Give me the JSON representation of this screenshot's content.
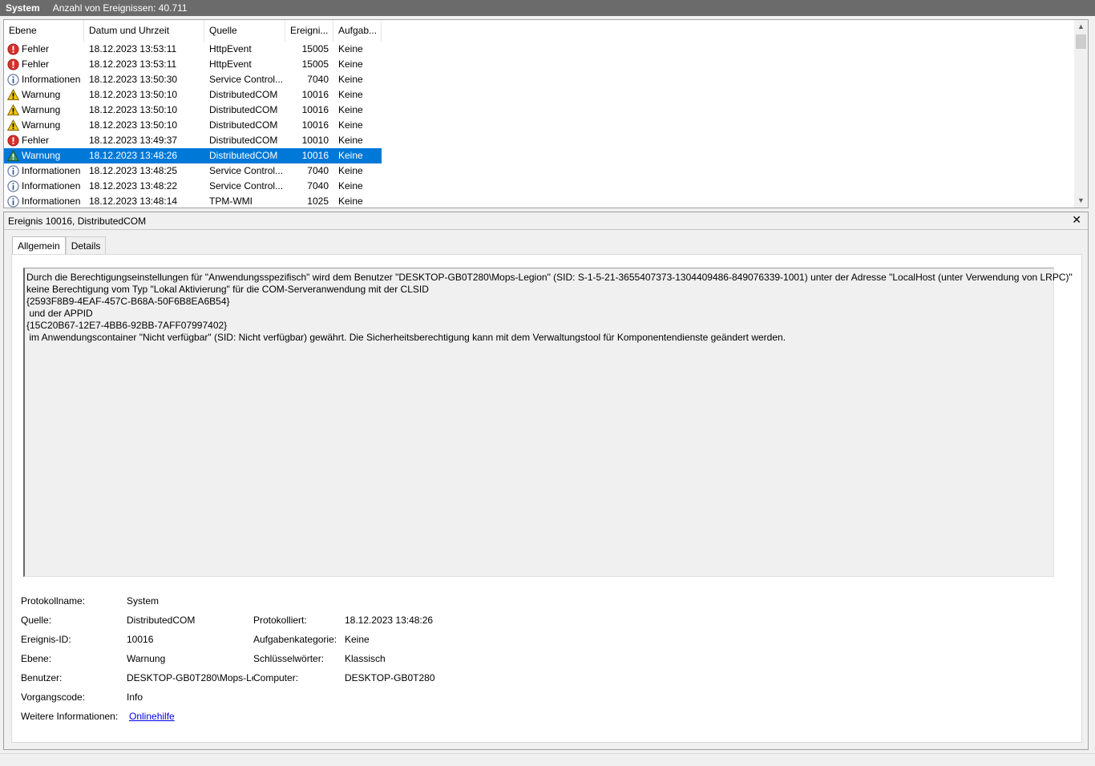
{
  "title_bar": {
    "log_name": "System",
    "event_count": "Anzahl von Ereignissen: 40.711"
  },
  "columns": [
    "Ebene",
    "Datum und Uhrzeit",
    "Quelle",
    "Ereigni...",
    "Aufgab..."
  ],
  "events": [
    {
      "level": "Fehler",
      "icon": "error-icon",
      "datetime": "18.12.2023 13:53:11",
      "source": "HttpEvent",
      "id": "15005",
      "task": "Keine"
    },
    {
      "level": "Fehler",
      "icon": "error-icon",
      "datetime": "18.12.2023 13:53:11",
      "source": "HttpEvent",
      "id": "15005",
      "task": "Keine"
    },
    {
      "level": "Informationen",
      "icon": "info-icon",
      "datetime": "18.12.2023 13:50:30",
      "source": "Service Control...",
      "id": "7040",
      "task": "Keine"
    },
    {
      "level": "Warnung",
      "icon": "warning-icon",
      "datetime": "18.12.2023 13:50:10",
      "source": "DistributedCOM",
      "id": "10016",
      "task": "Keine"
    },
    {
      "level": "Warnung",
      "icon": "warning-icon",
      "datetime": "18.12.2023 13:50:10",
      "source": "DistributedCOM",
      "id": "10016",
      "task": "Keine"
    },
    {
      "level": "Warnung",
      "icon": "warning-icon",
      "datetime": "18.12.2023 13:50:10",
      "source": "DistributedCOM",
      "id": "10016",
      "task": "Keine"
    },
    {
      "level": "Fehler",
      "icon": "error-icon",
      "datetime": "18.12.2023 13:49:37",
      "source": "DistributedCOM",
      "id": "10010",
      "task": "Keine"
    },
    {
      "level": "Warnung",
      "icon": "warning-icon",
      "datetime": "18.12.2023 13:48:26",
      "source": "DistributedCOM",
      "id": "10016",
      "task": "Keine",
      "selected": true
    },
    {
      "level": "Informationen",
      "icon": "info-icon",
      "datetime": "18.12.2023 13:48:25",
      "source": "Service Control...",
      "id": "7040",
      "task": "Keine"
    },
    {
      "level": "Informationen",
      "icon": "info-icon",
      "datetime": "18.12.2023 13:48:22",
      "source": "Service Control...",
      "id": "7040",
      "task": "Keine"
    },
    {
      "level": "Informationen",
      "icon": "info-icon",
      "datetime": "18.12.2023 13:48:14",
      "source": "TPM-WMI",
      "id": "1025",
      "task": "Keine"
    }
  ],
  "detail": {
    "header": "Ereignis 10016, DistributedCOM",
    "tabs": {
      "general": "Allgemein",
      "details": "Details"
    },
    "message_lines": [
      "Durch die Berechtigungseinstellungen für \"Anwendungsspezifisch\" wird dem Benutzer \"DESKTOP-GB0T280\\Mops-Legion\" (SID: S-1-5-21-3655407373-1304409486-849076339-1001) unter der Adresse \"LocalHost (unter Verwendung von LRPC)\"",
      "keine Berechtigung vom Typ \"Lokal Aktivierung\" für die COM-Serveranwendung mit der CLSID",
      "{2593F8B9-4EAF-457C-B68A-50F6B8EA6B54}",
      " und der APPID",
      "{15C20B67-12E7-4BB6-92BB-7AFF07997402}",
      " im Anwendungscontainer \"Nicht verfügbar\" (SID: Nicht verfügbar) gewährt. Die Sicherheitsberechtigung kann mit dem Verwaltungstool für Komponentendienste geändert werden."
    ],
    "props": {
      "log_name_label": "Protokollname:",
      "log_name": "System",
      "source_label": "Quelle:",
      "source": "DistributedCOM",
      "logged_label": "Protokolliert:",
      "logged": "18.12.2023 13:48:26",
      "event_id_label": "Ereignis-ID:",
      "event_id": "10016",
      "task_label": "Aufgabenkategorie:",
      "task": "Keine",
      "level_label": "Ebene:",
      "level": "Warnung",
      "keywords_label": "Schlüsselwörter:",
      "keywords": "Klassisch",
      "user_label": "Benutzer:",
      "user": "DESKTOP-GB0T280\\Mops-Le",
      "computer_label": "Computer:",
      "computer": "DESKTOP-GB0T280",
      "opcode_label": "Vorgangscode:",
      "opcode": "Info",
      "more_info_label": "Weitere Informationen:",
      "more_info_link": "Onlinehilfe"
    }
  }
}
